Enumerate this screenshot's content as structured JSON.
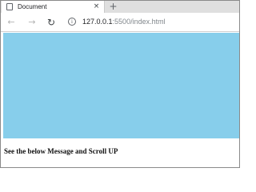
{
  "browser": {
    "tab": {
      "title": "Document",
      "close_glyph": "×",
      "favicon": "document-icon"
    },
    "new_tab_glyph": "+",
    "toolbar": {
      "back_glyph": "←",
      "forward_glyph": "→",
      "reload_glyph": "↻",
      "info_glyph": "i",
      "url_host": "127.0.0.1",
      "url_rest": ":5500/index.html"
    }
  },
  "page": {
    "block_color": "#87ceeb",
    "message": "See the below Message and Scroll UP"
  }
}
